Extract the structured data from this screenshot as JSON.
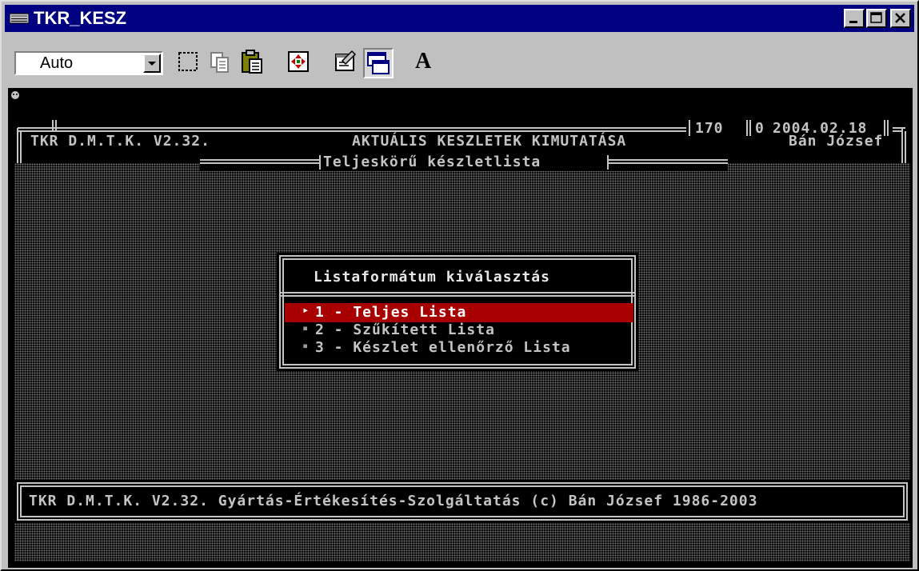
{
  "window": {
    "title": "TKR_KESZ",
    "controls": [
      "minimize",
      "maximize",
      "close"
    ]
  },
  "toolbar": {
    "font_select_value": "Auto",
    "tools": [
      "mark-icon",
      "copy-icon",
      "paste-icon",
      "full-screen-icon",
      "properties-icon",
      "background-icon",
      "font-icon"
    ],
    "font_button_label": "A"
  },
  "console": {
    "header": {
      "left": "TKR D.M.T.K. V2.32.",
      "center": "AKTUÁLIS KESZLETEK KIMUTATÁSA",
      "counter": "170",
      "counter2": "0",
      "date": "2004.02.18",
      "user": "Bán József",
      "subtitle": "Teljeskörű készletlista"
    },
    "menu": {
      "title": "Listaformátum kiválasztás",
      "items": [
        {
          "marker": "▸",
          "label": "1 - Teljes Lista"
        },
        {
          "marker": "▪",
          "label": "2 - Szűkített Lista"
        },
        {
          "marker": "▪",
          "label": "3 - Készlet ellenőrző Lista"
        }
      ],
      "selected_index": 0
    },
    "footer": "TKR D.M.T.K. V2.32. Gyártás-Értékesítés-Szolgáltatás (c) Bán József 1986-2003"
  },
  "colors": {
    "titlebar": "#000080",
    "highlight": "#a80000",
    "console_text": "#c4c4c4"
  }
}
